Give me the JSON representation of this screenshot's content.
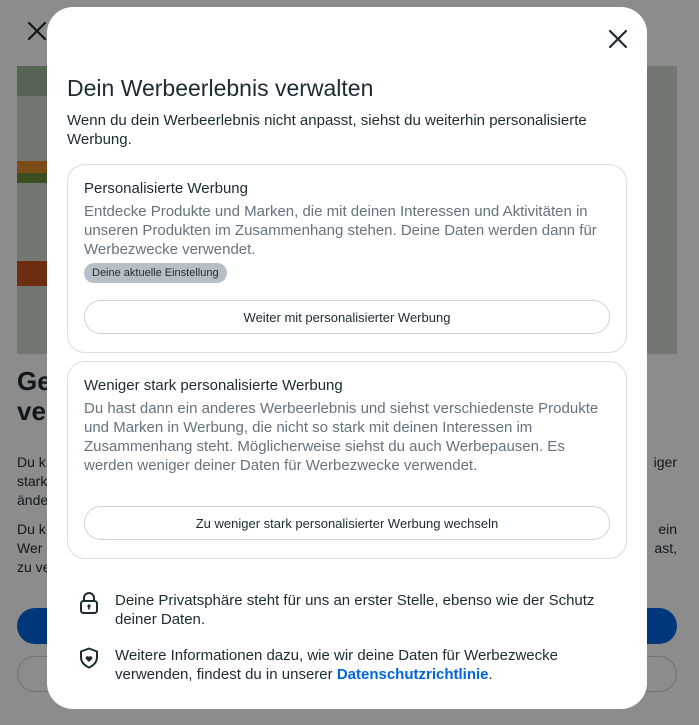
{
  "background": {
    "heading_fragment_1": "Ge",
    "heading_fragment_2": "ver",
    "para1_left": [
      "Du k",
      "stark",
      "ände"
    ],
    "para1_right": "iger",
    "para2_left": [
      "Du k",
      "Wer",
      "zu ve"
    ],
    "para2_right": [
      "ein",
      "ast,"
    ]
  },
  "dialog": {
    "title": "Dein Werbeerlebnis verwalten",
    "intro": "Wenn du dein Werbeerlebnis nicht anpasst, siehst du weiterhin personalisierte Werbung.",
    "close_icon": "close-icon"
  },
  "options": [
    {
      "title": "Personalisierte Werbung",
      "description": "Entdecke Produkte und Marken, die mit deinen Interessen und Aktivitäten in unseren Produkten im Zusammenhang stehen. Deine Daten werden dann für Werbezwecke verwendet.",
      "badge": "Deine aktuelle Einstellung",
      "button": "Weiter mit personalisierter Werbung"
    },
    {
      "title": "Weniger stark personalisierte Werbung",
      "description": "Du hast dann ein anderes Werbeerlebnis und siehst verschiedenste Produkte und Marken in Werbung, die nicht so stark mit deinen Interessen im Zusammenhang steht. Möglicherweise siehst du auch Werbepausen. Es werden weniger deiner Daten für Werbezwecke verwendet.",
      "button": "Zu weniger stark personalisierter Werbung wechseln"
    }
  ],
  "info": {
    "privacy": {
      "icon": "lock-icon",
      "text": "Deine Privatsphäre steht für uns an erster Stelle, ebenso wie der Schutz deiner Daten."
    },
    "policy": {
      "icon": "shield-icon",
      "text_before": "Weitere Informationen dazu, wie wir deine Daten für Werbezwecke verwenden, findest du in unserer ",
      "link": "Datenschutzrichtlinie",
      "text_after": "."
    }
  },
  "colors": {
    "accent": "#0064e0",
    "text": "#1c2b33",
    "secondary_text": "#65737e",
    "badge_bg": "#b7bfc6"
  }
}
